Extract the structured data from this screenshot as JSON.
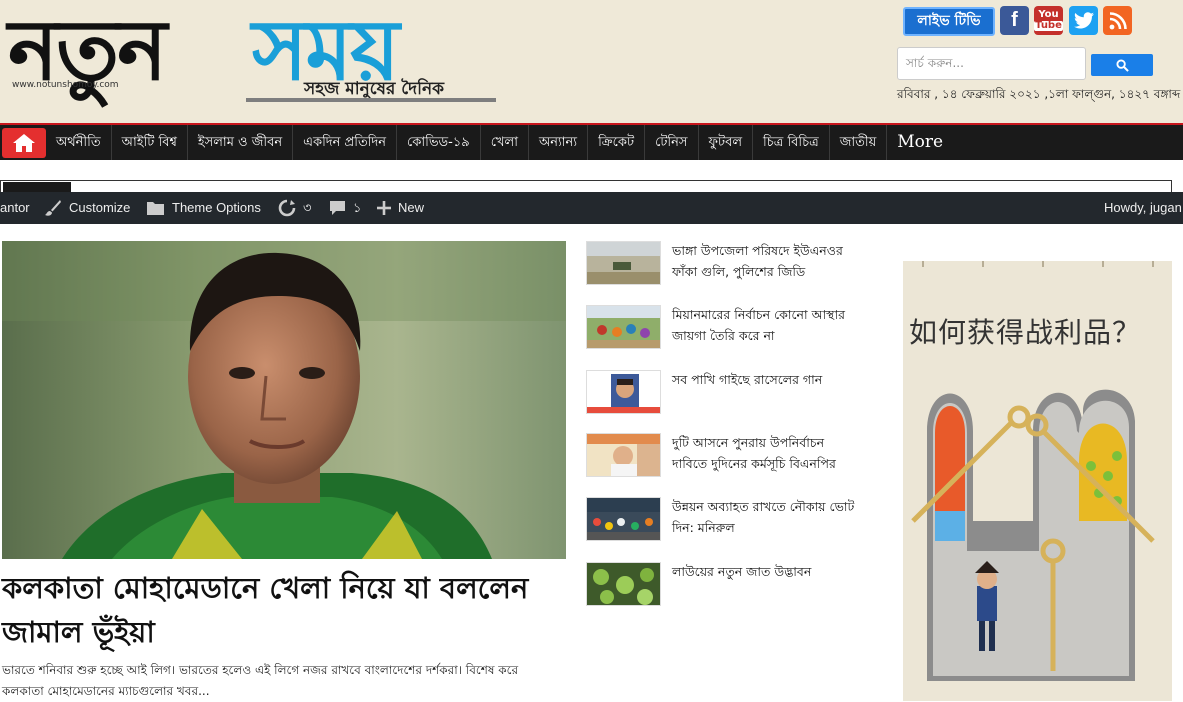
{
  "header": {
    "logo_black": "নতুন",
    "logo_blue": "সময়",
    "tagline": "সহজ মানুষের দৈনিক",
    "url": "www.notunshomoy.com",
    "live_tv": "লাইভ টিভি",
    "search_placeholder": "সার্চ করুন...",
    "date": "রবিবার , ১৪ ফেব্রুয়ারি ২০২১ ,১লা ফাল্গুন, ১৪২৭ বঙ্গাব্দ",
    "social": {
      "facebook": "f",
      "youtube_top": "You",
      "youtube_bottom": "Tube"
    }
  },
  "nav": {
    "items": [
      "অর্থনীতি",
      "আইটি বিশ্ব",
      "ইসলাম ও জীবন",
      "একদিন প্রতিদিন",
      "কোভিড-১৯",
      "খেলা",
      "অন্যান্য",
      "ক্রিকেট",
      "টেনিস",
      "ফুটবল",
      "চিত্র বিচিত্র",
      "জাতীয়"
    ],
    "more": "More"
  },
  "adminbar": {
    "left_partial": "antor",
    "customize": "Customize",
    "theme_options": "Theme Options",
    "updates_count": "৩",
    "comments_count": "১",
    "new": "New",
    "howdy": "Howdy, jugan"
  },
  "lead": {
    "title": "কলকাতা মোহামেডানে খেলা নিয়ে যা বললেন জামাল ভূঁইয়া",
    "excerpt": "ভারতে শনিবার শুরু হচ্ছে আই লিগ। ভারতের হলেও এই লিগে নজর রাখবে বাংলাদেশের দর্শকরা।  বিশেষ করে কলকাতা মোহামেডানের ম্যাচগুলোর খবর..."
  },
  "news": [
    {
      "title": "ভাঙ্গা উপজেলা পরিষদে ইউএনওর ফাঁকা গুলি, পুলিশের জিডি"
    },
    {
      "title": "মিয়ানমারের নির্বাচন কোনো আস্থার জায়গা তৈরি করে না"
    },
    {
      "title": "সব পাখি গাইছে রাসেলের গান"
    },
    {
      "title": "দুটি আসনে পুনরায় উপনির্বাচন দাবিতে দুদিনের কর্মসূচি বিএনপির"
    },
    {
      "title": "উন্নয়ন অব্যাহত রাখতে নৌকায় ভোট দিন: মনিরুল"
    },
    {
      "title": "লাউয়ের নতুন জাত উদ্ভাবন"
    }
  ],
  "ad": {
    "headline": "如何获得战利品？"
  }
}
